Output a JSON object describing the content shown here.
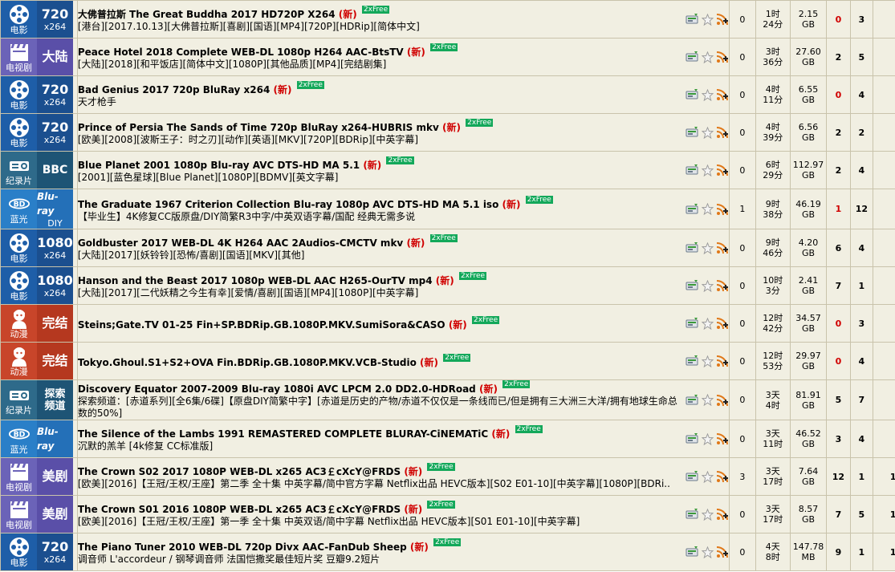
{
  "free_label": "2xFree",
  "new_label": "(新)",
  "colors": {
    "row_bg": "#f1efe2",
    "new": "#d00000",
    "free_bg": "#13a85a",
    "movie": "#1e5ea8",
    "tv": "#6b63b8",
    "doc": "#2e6a8a",
    "bluray": "#2a7fc8",
    "anime": "#c8452a"
  },
  "torrents": [
    {
      "cat_type": "movie",
      "cat_label": "电影",
      "cat_big": "720",
      "cat_small": "x264",
      "title": "大佛普拉斯 The Great Buddha 2017 HD720P X264",
      "desc": "[港台][2017.10.13][大佛普拉斯][喜剧][国语][MP4][720P][HDRip][简体中文]",
      "comments": "0",
      "time1": "1时",
      "time2": "24分",
      "size1": "2.15",
      "size2": "GB",
      "seeders": "0",
      "leechers": "3",
      "completed": "0"
    },
    {
      "cat_type": "tv",
      "cat_label": "电视剧",
      "cat_big": "大陆",
      "cat_small": "",
      "title": "Peace Hotel 2018 Complete WEB-DL 1080p H264 AAC-BtsTV",
      "desc": "[大陆][2018][和平饭店][简体中文][1080P][其他品质][MP4][完结剧集]",
      "comments": "0",
      "time1": "3时",
      "time2": "36分",
      "size1": "27.60",
      "size2": "GB",
      "seeders": "2",
      "leechers": "5",
      "completed": "0"
    },
    {
      "cat_type": "movie",
      "cat_label": "电影",
      "cat_big": "720",
      "cat_small": "x264",
      "title": "Bad Genius 2017 720p BluRay x264",
      "desc": "天才枪手",
      "comments": "0",
      "time1": "4时",
      "time2": "11分",
      "size1": "6.55",
      "size2": "GB",
      "seeders": "0",
      "leechers": "4",
      "completed": "0"
    },
    {
      "cat_type": "movie",
      "cat_label": "电影",
      "cat_big": "720",
      "cat_small": "x264",
      "title": "Prince of Persia The Sands of Time 720p BluRay x264-HUBRIS mkv",
      "desc": "[欧美][2008][波斯王子：时之刃][动作][英语][MKV][720P][BDRip][中英字幕]",
      "comments": "0",
      "time1": "4时",
      "time2": "39分",
      "size1": "6.56",
      "size2": "GB",
      "seeders": "2",
      "leechers": "2",
      "completed": "1"
    },
    {
      "cat_type": "doc",
      "cat_label": "纪录片",
      "cat_big": "BBC",
      "cat_small": "",
      "title": "Blue Planet 2001 1080p Blu-ray AVC DTS-HD MA 5.1",
      "desc": "[2001][蓝色星球][Blue Planet][1080P][BDMV][英文字幕]",
      "comments": "0",
      "time1": "6时",
      "time2": "29分",
      "size1": "112.97",
      "size2": "GB",
      "seeders": "2",
      "leechers": "4",
      "completed": "1"
    },
    {
      "cat_type": "bluray",
      "cat_label": "蓝光",
      "cat_big": "Blu-ray",
      "cat_small": "DIY",
      "title": "The Graduate 1967 Criterion Collection Blu-ray 1080p AVC DTS-HD MA 5.1 iso",
      "desc": "【毕业生】4K修复CC版原盘/DIY简繁R3中字/中英双语字幕/国配 经典无需多说",
      "comments": "1",
      "time1": "9时",
      "time2": "38分",
      "size1": "46.19",
      "size2": "GB",
      "seeders": "1",
      "leechers": "12",
      "completed": "0"
    },
    {
      "cat_type": "movie",
      "cat_label": "电影",
      "cat_big": "1080",
      "cat_small": "x264",
      "title": "Goldbuster 2017 WEB-DL 4K H264 AAC 2Audios-CMCTV mkv",
      "desc": "[大陆][2017][妖铃铃][恐怖/喜剧][国语][MKV][其他]",
      "comments": "0",
      "time1": "9时",
      "time2": "46分",
      "size1": "4.20",
      "size2": "GB",
      "seeders": "6",
      "leechers": "4",
      "completed": "7"
    },
    {
      "cat_type": "movie",
      "cat_label": "电影",
      "cat_big": "1080",
      "cat_small": "x264",
      "title": "Hanson and the Beast 2017 1080p WEB-DL AAC H265-OurTV mp4",
      "desc": "[大陆][2017][二代妖精之今生有幸][爱情/喜剧][国语][MP4][1080P][中英字幕]",
      "comments": "0",
      "time1": "10时",
      "time2": "3分",
      "size1": "2.41",
      "size2": "GB",
      "seeders": "7",
      "leechers": "1",
      "completed": "7"
    },
    {
      "cat_type": "anime",
      "cat_label": "动漫",
      "cat_big": "完结",
      "cat_small": "",
      "title": "Steins;Gate.TV 01-25 Fin+SP.BDRip.GB.1080P.MKV.SumiSora&CASO",
      "desc": "",
      "comments": "0",
      "time1": "12时",
      "time2": "42分",
      "size1": "34.57",
      "size2": "GB",
      "seeders": "0",
      "leechers": "3",
      "completed": "0"
    },
    {
      "cat_type": "anime",
      "cat_label": "动漫",
      "cat_big": "完结",
      "cat_small": "",
      "title": "Tokyo.Ghoul.S1+S2+OVA Fin.BDRip.GB.1080P.MKV.VCB-Studio",
      "desc": "",
      "comments": "0",
      "time1": "12时",
      "time2": "53分",
      "size1": "29.97",
      "size2": "GB",
      "seeders": "0",
      "leechers": "4",
      "completed": "0"
    },
    {
      "cat_type": "doc",
      "cat_label": "纪录片",
      "cat_big": "探索",
      "cat_big2": "频道",
      "cat_small": "",
      "title": "Discovery Equator 2007-2009 Blu-ray 1080i AVC LPCM 2.0 DD2.0-HDRoad",
      "desc": "探索频道：[赤道系列][全6集/6碟]【原盘DIY简繁中字】[赤道是历史的产物/赤道不仅仅是一条线而已/但是拥有三大洲三大洋/拥有地球生命总数的50%]",
      "comments": "0",
      "time1": "3天",
      "time2": "4时",
      "size1": "81.91",
      "size2": "GB",
      "seeders": "5",
      "leechers": "7",
      "completed": "6"
    },
    {
      "cat_type": "bluray",
      "cat_label": "蓝光",
      "cat_big": "Blu-ray",
      "cat_small": "",
      "title": "The Silence of the Lambs 1991 REMASTERED COMPLETE BLURAY-CiNEMATiC",
      "desc": "沉默的羔羊 [4k修复 CC标准版]",
      "comments": "0",
      "time1": "3天",
      "time2": "11时",
      "size1": "46.52",
      "size2": "GB",
      "seeders": "3",
      "leechers": "4",
      "completed": "0"
    },
    {
      "cat_type": "tv",
      "cat_label": "电视剧",
      "cat_big": "美剧",
      "cat_small": "",
      "title": "The Crown S02 2017 1080P WEB-DL x265 AC3￡cXcY@FRDS",
      "desc": "[欧美][2016]【王冠/王权/王座】第二季 全十集 中英字幕/简中官方字幕 Netflix出品 HEVC版本][S02 E01-10][中英字幕][1080P][BDRi..",
      "comments": "3",
      "time1": "3天",
      "time2": "17时",
      "size1": "7.64",
      "size2": "GB",
      "seeders": "12",
      "leechers": "1",
      "completed": "19"
    },
    {
      "cat_type": "tv",
      "cat_label": "电视剧",
      "cat_big": "美剧",
      "cat_small": "",
      "title": "The Crown S01 2016 1080P WEB-DL x265 AC3￡cXcY@FRDS",
      "desc": "[欧美][2016]【王冠/王权/王座】第一季 全十集 中英双语/简中字幕 Netflix出品 HEVC版本][S01 E01-10][中英字幕]",
      "comments": "0",
      "time1": "3天",
      "time2": "17时",
      "size1": "8.57",
      "size2": "GB",
      "seeders": "7",
      "leechers": "5",
      "completed": "12"
    },
    {
      "cat_type": "movie",
      "cat_label": "电影",
      "cat_big": "720",
      "cat_small": "x264",
      "title": "The Piano Tuner 2010 WEB-DL 720p Divx AAC-FanDub Sheep",
      "desc": "调音师 L'accordeur / 钢琴调音师 法国恺撒奖最佳短片奖 豆瓣9.2短片",
      "comments": "0",
      "time1": "4天",
      "time2": "8时",
      "size1": "147.78",
      "size2": "MB",
      "seeders": "9",
      "leechers": "1",
      "completed": "16"
    }
  ]
}
